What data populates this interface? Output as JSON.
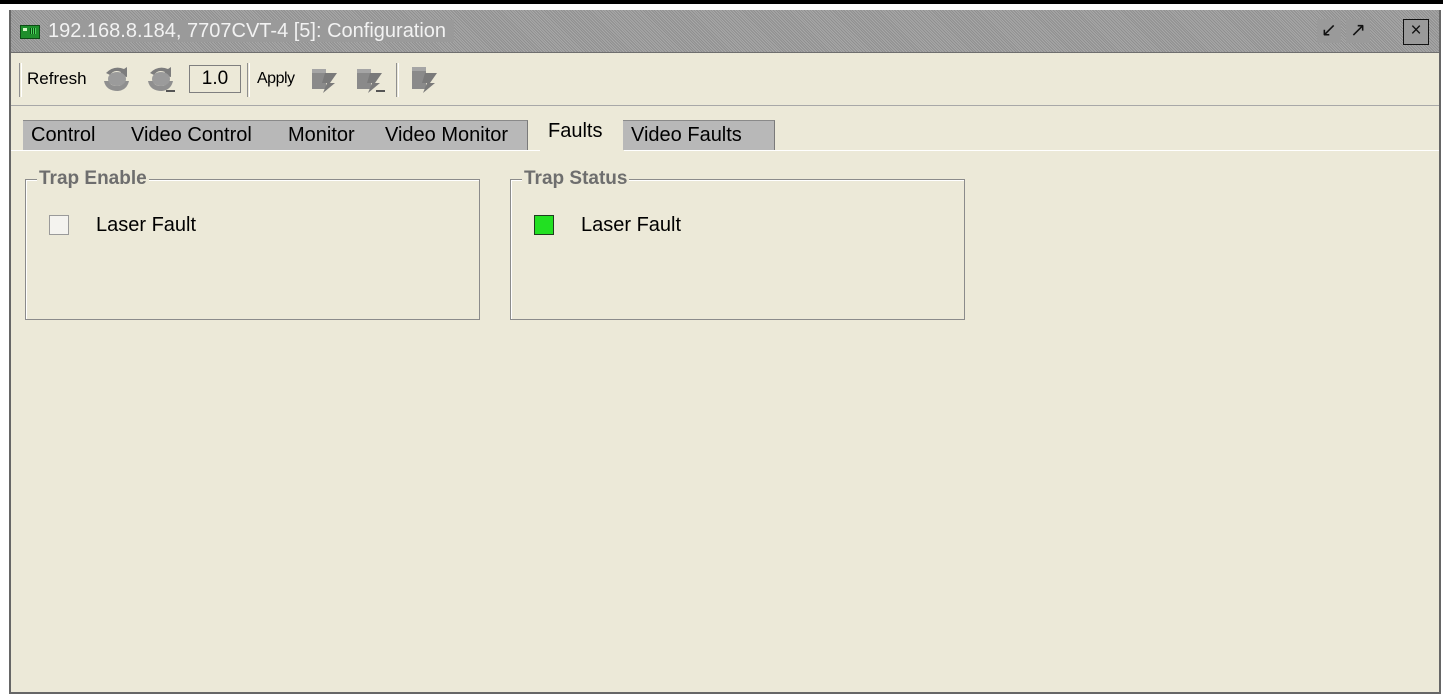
{
  "window": {
    "title": "192.168.8.184, 7707CVT-4  [5]: Configuration",
    "icons": [
      "device-icon",
      "restore-icon",
      "maximize-icon",
      "close-icon"
    ]
  },
  "toolbar": {
    "refresh_label": "Refresh",
    "refresh_icons": [
      "refresh-icon",
      "refresh-partial-icon"
    ],
    "version_value": "1.0",
    "apply_label": "Apply",
    "apply_icons": [
      "apply-icon",
      "apply-partial-icon",
      "apply-all-icon"
    ]
  },
  "tabs": [
    {
      "label": "Control",
      "active": false
    },
    {
      "label": "Video Control",
      "active": false
    },
    {
      "label": "Monitor",
      "active": false
    },
    {
      "label": "Video Monitor",
      "active": false
    },
    {
      "label": "Faults",
      "active": true
    },
    {
      "label": "Video Faults",
      "active": false
    }
  ],
  "trap_enable": {
    "title": "Trap Enable",
    "items": [
      {
        "label": "Laser Fault",
        "checked": false
      }
    ]
  },
  "trap_status": {
    "title": "Trap Status",
    "items": [
      {
        "label": "Laser Fault",
        "status_color": "#22e022"
      }
    ]
  },
  "colors": {
    "background": "#ece9d8",
    "titlebar": "#9a9a9a",
    "tab_inactive": "#b8b8b8",
    "status_ok": "#22e022"
  }
}
